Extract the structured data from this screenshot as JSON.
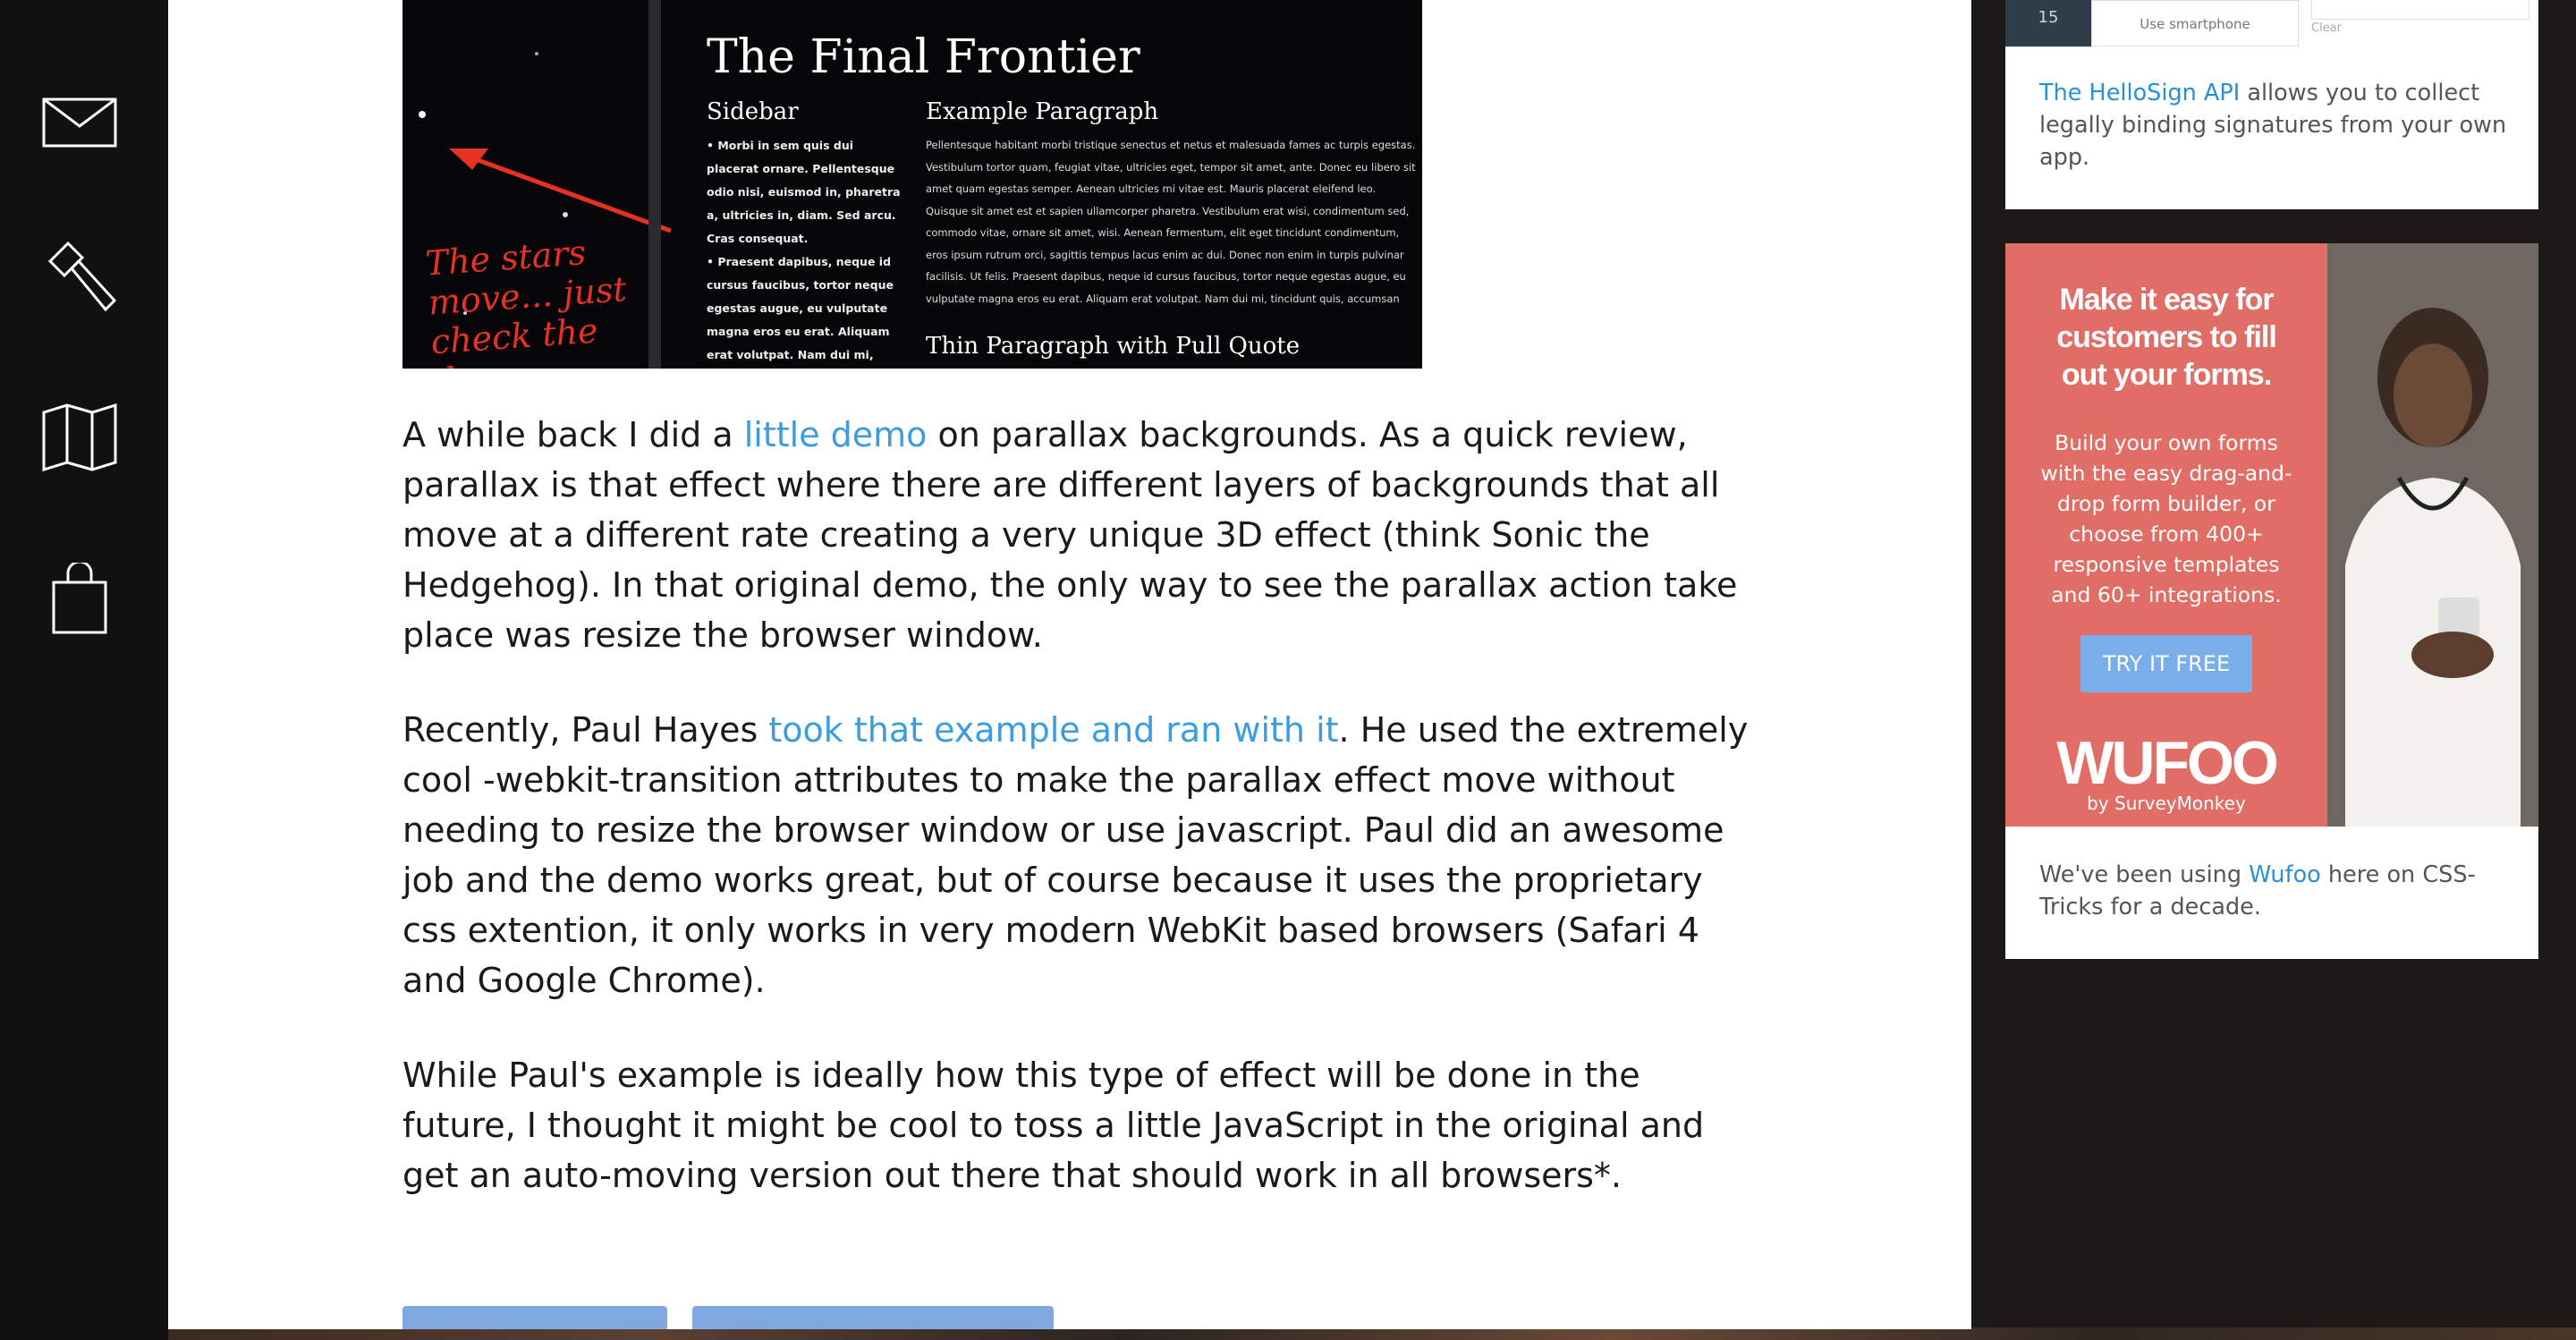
{
  "nav": {
    "items": [
      {
        "name": "mail-icon"
      },
      {
        "name": "hammer-icon"
      },
      {
        "name": "map-icon"
      },
      {
        "name": "shopping-bag-icon"
      }
    ]
  },
  "hero": {
    "title": "The Final Frontier",
    "sidebar_heading": "Sidebar",
    "sidebar_items": [
      "Morbi in sem quis dui placerat ornare. Pellentesque odio nisi, euismod in, pharetra a, ultricies in, diam. Sed arcu. Cras consequat.",
      "Praesent dapibus, neque id cursus faucibus, tortor neque egestas augue, eu vulputate magna eros eu erat. Aliquam erat volutpat. Nam dui mi,"
    ],
    "example_heading": "Example Paragraph",
    "example_text": "Pellentesque habitant morbi tristique senectus et netus et malesuada fames ac turpis egestas. Vestibulum tortor quam, feugiat vitae, ultricies eget, tempor sit amet, ante. Donec eu libero sit amet quam egestas semper. Aenean ultricies mi vitae est. Mauris placerat eleifend leo. Quisque sit amet est et sapien ullamcorper pharetra. Vestibulum erat wisi, condimentum sed, commodo vitae, ornare sit amet, wisi. Aenean fermentum, elit eget tincidunt condimentum, eros ipsum rutrum orci, sagittis tempus lacus enim ac dui. Donec non enim in turpis pulvinar facilisis. Ut felis. Praesent dapibus, neque id cursus faucibus, tortor neque egestas augue, eu vulputate magna eros eu erat. Aliquam erat volutpat. Nam dui mi, tincidunt quis, accumsan porttitor, facilisis luctus, metus.",
    "pull_heading": "Thin Paragraph with Pull Quote",
    "stars_note": "The stars move... just check the demo."
  },
  "article": {
    "p1": {
      "before": "A while back I did a ",
      "link": "little demo",
      "after": " on parallax backgrounds. As a quick review, parallax is that effect where there are different layers of backgrounds that all move at a different rate creating a very unique 3D effect (think Sonic the Hedgehog). In that original demo, the only way to see the parallax action take place was resize the browser window."
    },
    "p2": {
      "before": "Recently, Paul Hayes ",
      "link": "took that example and ran with it",
      "after": ". He used the extremely cool -webkit-transition attributes to make the parallax effect move without needing to resize the browser window or use javascript. Paul did an awesome job and the demo works great, but of course because it uses the proprietary css extention, it only works in very modern WebKit based browsers (Safari 4 and Google Chrome)."
    },
    "p3": "While Paul's example is ideally how this type of effect will be done in the future, I thought it might be cool to toss a little JavaScript in the original and get an auto-moving version out there that should work in all browsers*."
  },
  "sidebar": {
    "hellosign": {
      "mini_number": "15",
      "mini_button": "Use smartphone",
      "mini_clear": "Clear",
      "link": "The HelloSign API",
      "text": " allows you to collect legally binding signatures from your own app."
    },
    "wufoo_ad": {
      "headline": "Make it easy for customers to fill out your forms.",
      "body": "Build your own forms with the easy drag-and-drop form builder, or choose from 400+ responsive templates and 60+ integrations.",
      "button": "TRY IT FREE",
      "logo": "WUFOO",
      "logo_sub": "by SurveyMonkey",
      "accent": "#e06e66"
    },
    "wufoo_note": {
      "before": "We've been using ",
      "link": "Wufoo",
      "after": " here on CSS-Tricks for a decade."
    }
  }
}
